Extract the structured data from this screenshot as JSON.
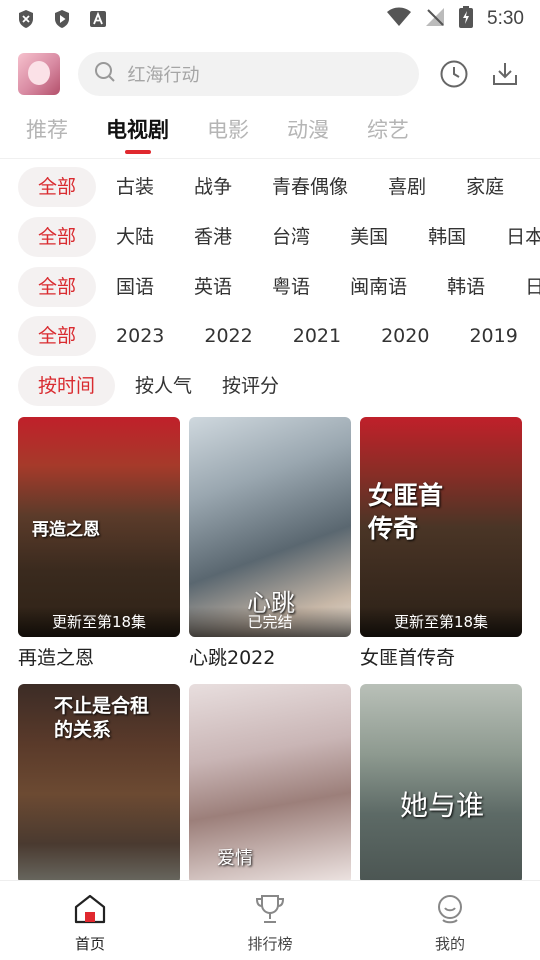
{
  "status_bar": {
    "time": "5:30",
    "left_icons": [
      "shield-x-icon",
      "play-shield-icon",
      "a-box-icon"
    ],
    "right_icons": [
      "wifi-icon",
      "no-signal-icon",
      "battery-charging-icon"
    ]
  },
  "header": {
    "search_placeholder": "红海行动",
    "icons": [
      "history-icon",
      "download-icon"
    ]
  },
  "tabs": [
    {
      "label": "推荐",
      "active": false
    },
    {
      "label": "电视剧",
      "active": true
    },
    {
      "label": "电影",
      "active": false
    },
    {
      "label": "动漫",
      "active": false
    },
    {
      "label": "综艺",
      "active": false
    }
  ],
  "filters": {
    "genre": [
      "全部",
      "古装",
      "战争",
      "青春偶像",
      "喜剧",
      "家庭"
    ],
    "region": [
      "全部",
      "大陆",
      "香港",
      "台湾",
      "美国",
      "韩国",
      "日本"
    ],
    "language": [
      "全部",
      "国语",
      "英语",
      "粤语",
      "闽南语",
      "韩语",
      "日"
    ],
    "year": [
      "全部",
      "2023",
      "2022",
      "2021",
      "2020",
      "2019"
    ],
    "sort": [
      "按时间",
      "按人气",
      "按评分"
    ]
  },
  "cards": [
    {
      "title": "再造之恩",
      "badge": "更新至第18集",
      "poster_text": "再造之恩"
    },
    {
      "title": "心跳2022",
      "badge": "已完结",
      "poster_text": "心跳"
    },
    {
      "title": "女匪首传奇",
      "badge": "更新至第18集",
      "poster_text": "女匪首传奇"
    },
    {
      "title": "",
      "badge": "",
      "poster_text": "不止是合租的关系"
    },
    {
      "title": "",
      "badge": "",
      "poster_text": "爱情"
    },
    {
      "title": "",
      "badge": "",
      "poster_text": "她与谁"
    }
  ],
  "bottom_nav": [
    {
      "label": "首页",
      "icon": "home-icon",
      "active": true
    },
    {
      "label": "排行榜",
      "icon": "trophy-icon",
      "active": false
    },
    {
      "label": "我的",
      "icon": "profile-icon",
      "active": false
    }
  ],
  "colors": {
    "accent": "#e0282e",
    "chip_selected_bg": "#f4f1f1",
    "chip_selected_text": "#d92b30"
  }
}
